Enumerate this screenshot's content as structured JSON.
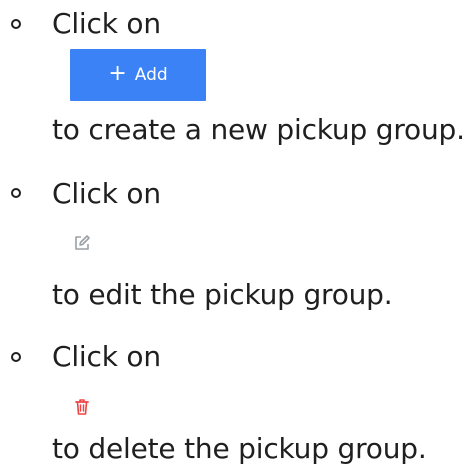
{
  "items": [
    {
      "click_text": "Click on",
      "control": {
        "type": "button",
        "icon": "plus-icon",
        "plus_glyph": "+",
        "label": "Add",
        "background": "#3b82f6",
        "text_color": "#ffffff"
      },
      "description": "to create a new pickup group."
    },
    {
      "click_text": "Click on",
      "control": {
        "type": "icon",
        "icon": "edit-icon",
        "color": "#9aa0a6"
      },
      "description": "to edit the pickup group."
    },
    {
      "click_text": "Click on",
      "control": {
        "type": "icon",
        "icon": "trash-icon",
        "color": "#ef4444"
      },
      "description": "to delete the pickup group."
    }
  ]
}
